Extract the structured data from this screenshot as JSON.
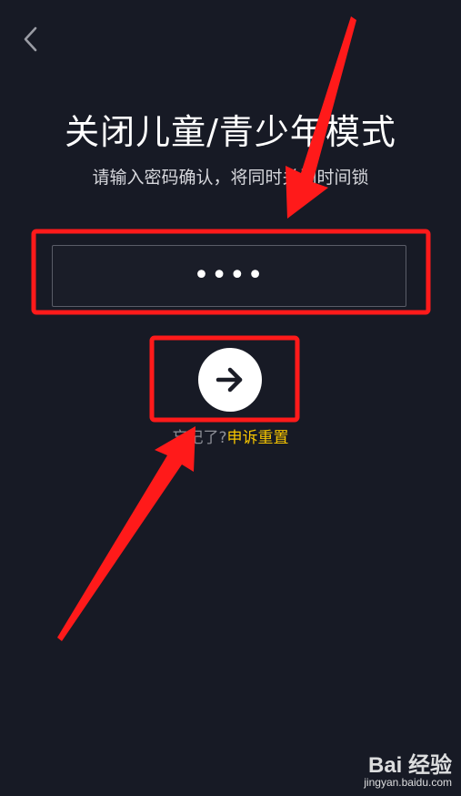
{
  "header": {
    "back_icon": "chevron-left-icon"
  },
  "main": {
    "title": "关闭儿童/青少年模式",
    "subtitle": "请输入密码确认，将同时关闭时间锁",
    "password_value": "••••",
    "submit_icon": "arrow-right-icon",
    "forgot_text": "忘记了?",
    "reset_link": "申诉重置"
  },
  "watermark": {
    "brand": "Bai 经验",
    "url": "jingyan.baidu.com"
  },
  "colors": {
    "background": "#171a25",
    "accent": "#f5c400",
    "annotation": "#ff1a1a"
  }
}
